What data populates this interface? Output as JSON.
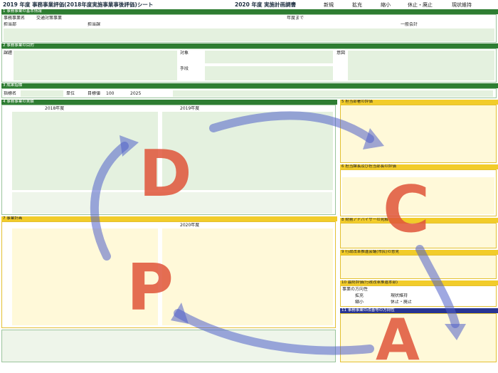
{
  "header": {
    "title": "2019 年度 事務事業評価(2018年度実施事業事後評価)シート",
    "sub_title": "2020 年度 実施計画調書",
    "options": [
      "新規",
      "拡充",
      "縮小",
      "休止・廃止",
      "現状維持"
    ]
  },
  "section1": {
    "title": "1 事務事業の基本情報",
    "event_name": "交通対策事業",
    "field_labels": [
      "事務事業名",
      "担当部",
      "担当課"
    ],
    "category": "一般会計",
    "period_label": "年度まで"
  },
  "section2": {
    "title": "2 事務事業の目的",
    "issue_label": "課題",
    "target_label": "対象",
    "action_label": "手段",
    "intent_label": "意図"
  },
  "section3": {
    "title": "3 成果指標",
    "indicator_label": "指標名",
    "unit_label": "単位",
    "target_label": "目標値",
    "target_value": "100",
    "year": "2025"
  },
  "section4": {
    "title": "4 事務事業の実績",
    "year_a": "2018年度",
    "year_b": "2019年度",
    "year_c": "2020年度"
  },
  "section5": {
    "title": "5 担当部署の評価"
  },
  "section6": {
    "title": "6 担当課長及び担当部長の評価"
  },
  "section7": {
    "title": "7 事業計画"
  },
  "section8": {
    "title": "8 財務アドバイザーの見解"
  },
  "section9": {
    "title": "9 行政改革推進会議(市民)の意見"
  },
  "section10": {
    "title": "10 最終評価(行政改革推進本部)",
    "direction_label": "事業の方向性",
    "options": [
      "拡充",
      "現状維持",
      "縮小",
      "休止・廃止"
    ]
  },
  "section11": {
    "title": "11 事務事業の改善等の方向性"
  },
  "labels": {
    "p": "P",
    "d": "D",
    "c": "C",
    "a": "A"
  },
  "colors": {
    "green": "#2e7d32",
    "yellow": "#f2cc2a",
    "orange": "#e0553a",
    "arrow": "#5060c8"
  }
}
